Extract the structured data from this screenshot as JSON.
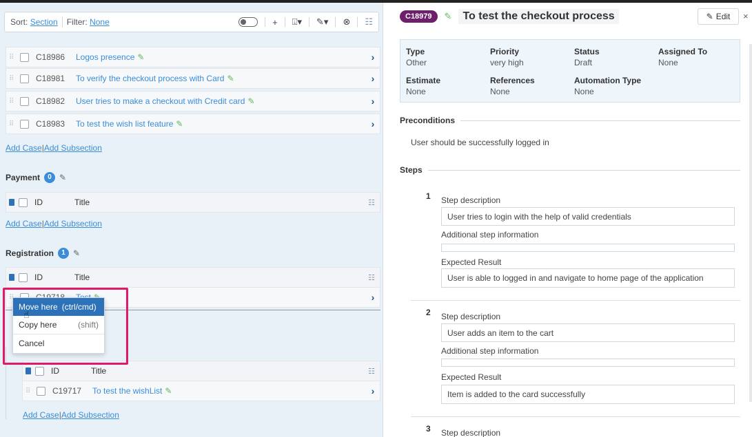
{
  "toolbar": {
    "sort_label": "Sort:",
    "sort_value": "Section",
    "filter_label": "Filter:",
    "filter_value": "None",
    "icons": [
      "toggle-icon",
      "plus-icon",
      "assign-icon",
      "pencil-icon",
      "cancel-icon",
      "columns-icon"
    ]
  },
  "rows_top": [
    {
      "id": "C18986",
      "title": "Logos presence"
    },
    {
      "id": "C18981",
      "title": "To verify the checkout process with Card"
    },
    {
      "id": "C18982",
      "title": "User tries to make a checkout with Credit card"
    },
    {
      "id": "C18983",
      "title": "To test the wish list feature"
    }
  ],
  "add_case": "Add Case",
  "add_subsection": "Add Subsection",
  "sep": "|",
  "payment": {
    "name": "Payment",
    "count": "0"
  },
  "registration": {
    "name": "Registration",
    "count": "1"
  },
  "table_header": {
    "id": "ID",
    "title": "Title"
  },
  "registration_row": {
    "id": "C19718",
    "title": "Test"
  },
  "nested_row": {
    "id": "C19717",
    "title": "To test the wishList"
  },
  "context_menu": {
    "move": {
      "label": "Move here",
      "hint": "(ctrl/cmd)"
    },
    "copy": {
      "label": "Copy here",
      "hint": "(shift)"
    },
    "cancel": {
      "label": "Cancel"
    }
  },
  "detail": {
    "id": "C18979",
    "title": "To test the checkout process",
    "edit_label": "Edit",
    "close": "×",
    "fields": {
      "type": {
        "k": "Type",
        "v": "Other"
      },
      "priority": {
        "k": "Priority",
        "v": "very high"
      },
      "status": {
        "k": "Status",
        "v": "Draft"
      },
      "assigned": {
        "k": "Assigned To",
        "v": "None"
      },
      "estimate": {
        "k": "Estimate",
        "v": "None"
      },
      "references": {
        "k": "References",
        "v": "None"
      },
      "automation": {
        "k": "Automation Type",
        "v": "None"
      }
    },
    "preconditions_title": "Preconditions",
    "preconditions_text": "User should be successfully logged in",
    "steps_title": "Steps",
    "labels": {
      "desc": "Step description",
      "add": "Additional step information",
      "expected": "Expected Result"
    },
    "steps": [
      {
        "num": "1",
        "desc": "User tries to login with the help of valid credentials",
        "add": "",
        "expected": "User is able to logged in and navigate to home page of the application"
      },
      {
        "num": "2",
        "desc": "User adds an item to the cart",
        "add": "",
        "expected": "Item is added to the card successfully"
      },
      {
        "num": "3"
      }
    ]
  }
}
